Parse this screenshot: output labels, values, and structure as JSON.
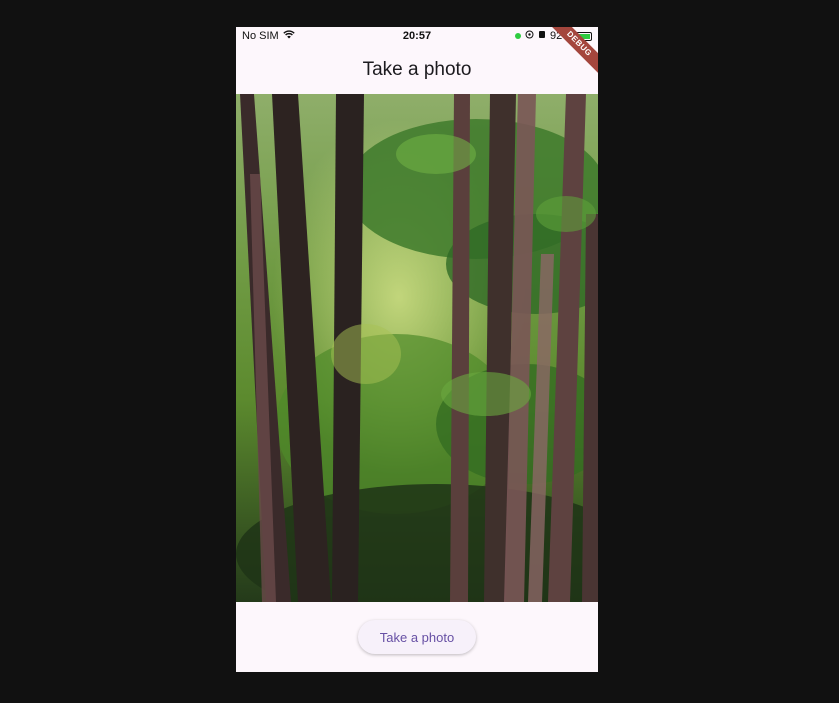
{
  "status_bar": {
    "carrier": "No SIM",
    "time": "20:57",
    "battery": "92%",
    "wifi_icon": "wifi-icon",
    "battery_icon": "battery-icon"
  },
  "app_bar": {
    "title": "Take a photo"
  },
  "debug_banner": "DEBUG",
  "photo": {
    "icon": "forest-photo"
  },
  "action": {
    "button_label": "Take a photo"
  }
}
